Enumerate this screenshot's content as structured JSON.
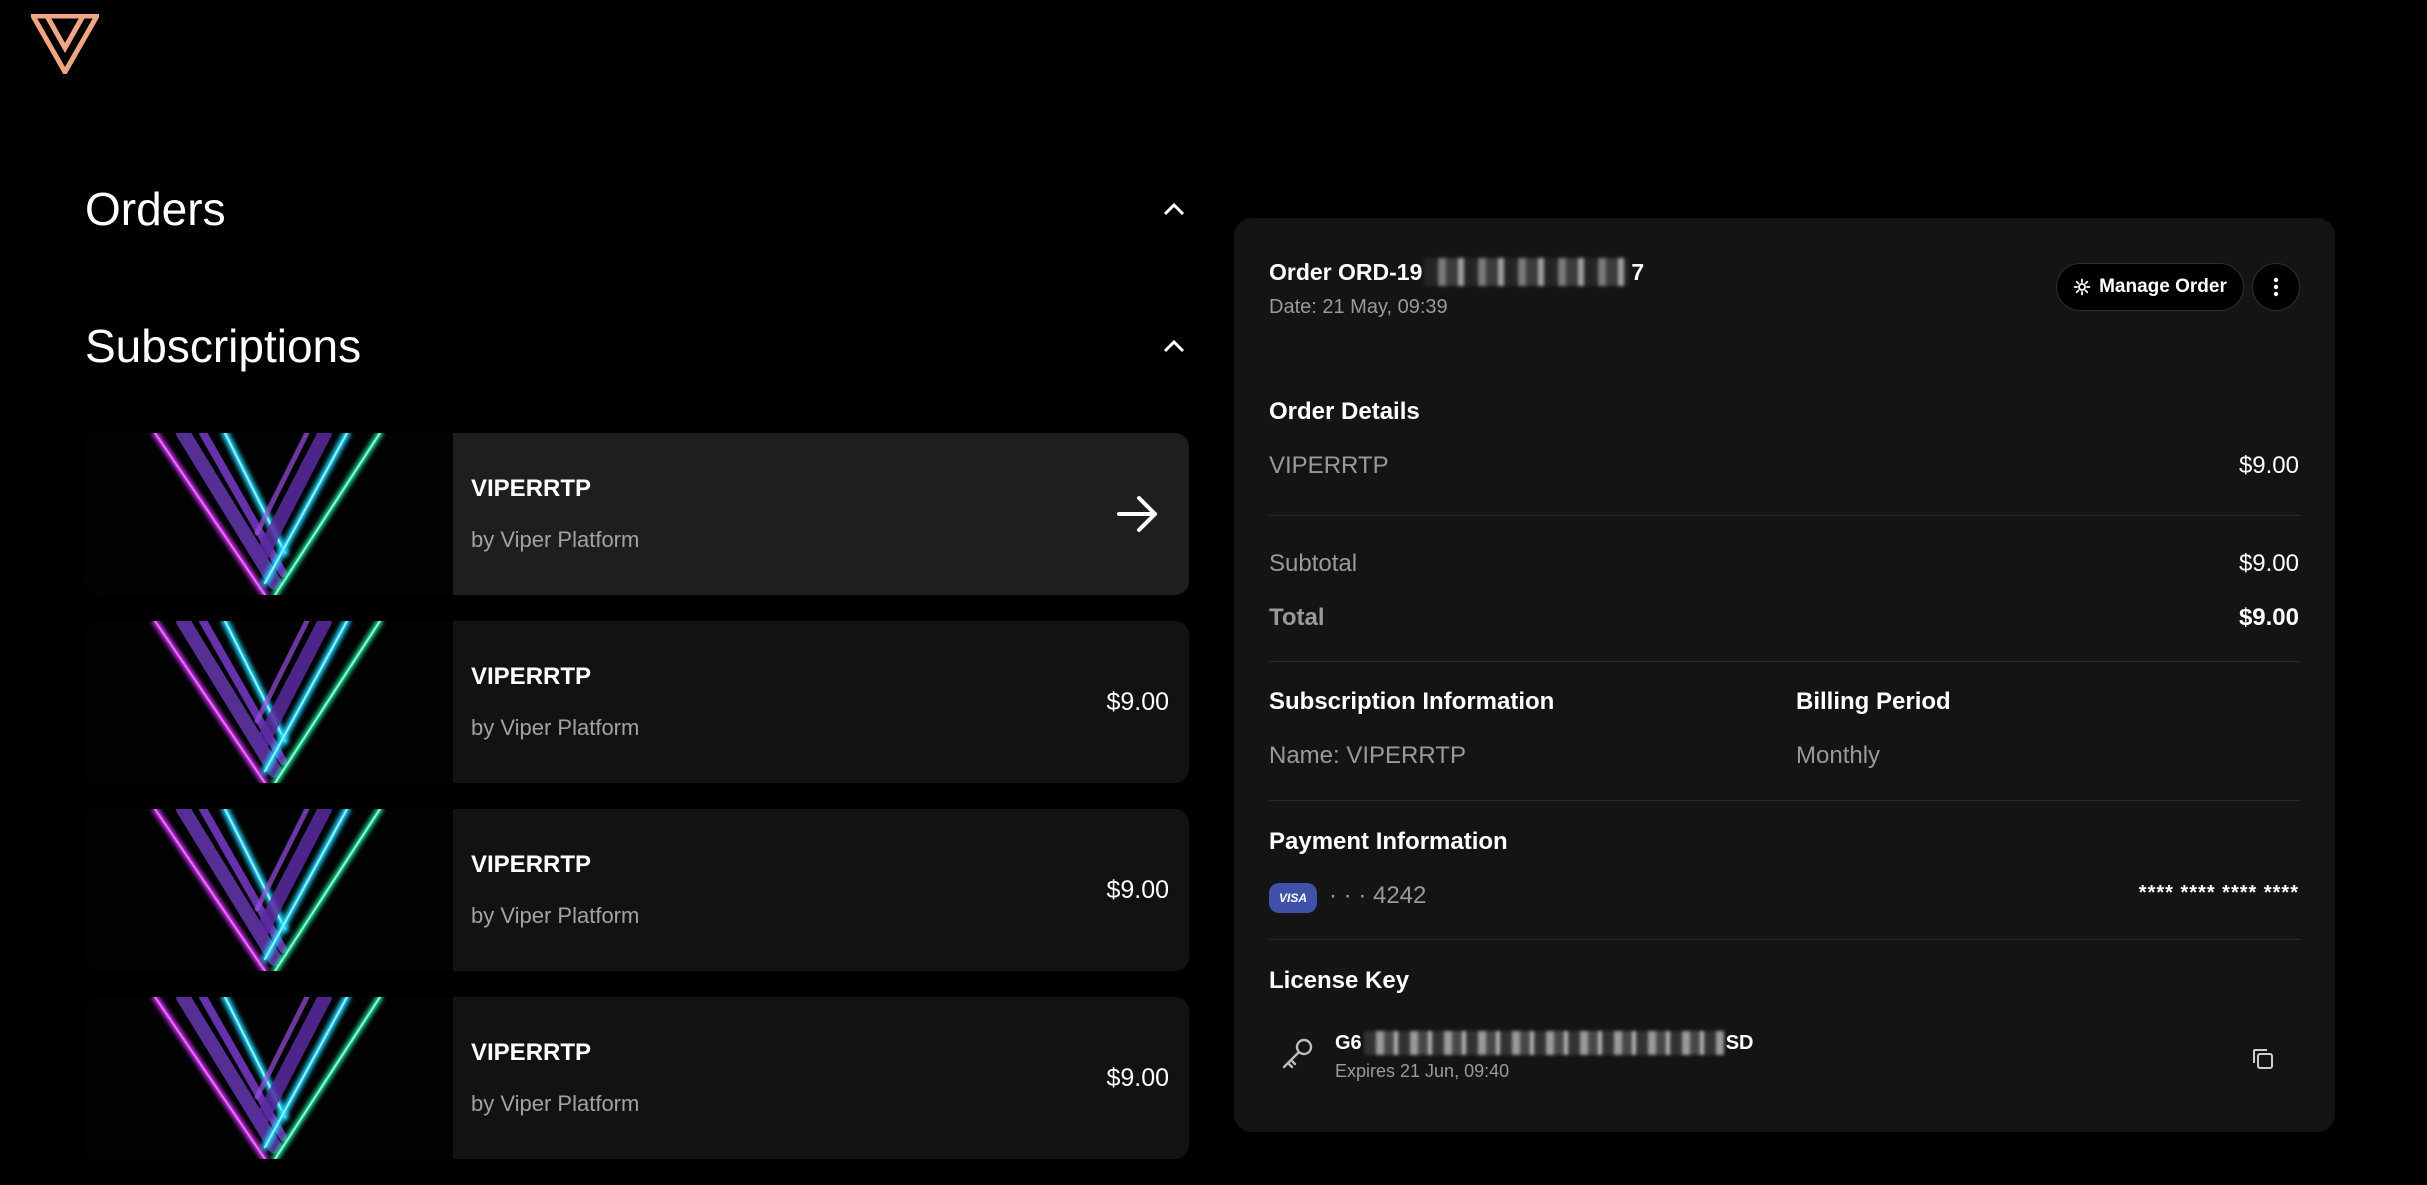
{
  "logo": "viper-logo",
  "sections": {
    "orders_title": "Orders",
    "subscriptions_title": "Subscriptions"
  },
  "subscriptions": [
    {
      "name": "VIPERRTP",
      "by": "by Viper Platform",
      "price": ""
    },
    {
      "name": "VIPERRTP",
      "by": "by Viper Platform",
      "price": "$9.00"
    },
    {
      "name": "VIPERRTP",
      "by": "by Viper Platform",
      "price": "$9.00"
    },
    {
      "name": "VIPERRTP",
      "by": "by Viper Platform",
      "price": "$9.00"
    }
  ],
  "order": {
    "title_prefix": "Order ORD-19",
    "title_suffix": "7",
    "date": "Date: 21 May, 09:39",
    "manage_label": "Manage Order",
    "details_heading": "Order Details",
    "item_name": "VIPERRTP",
    "item_price": "$9.00",
    "subtotal_label": "Subtotal",
    "subtotal_value": "$9.00",
    "total_label": "Total",
    "total_value": "$9.00",
    "subscription_heading": "Subscription Information",
    "subscription_name": "Name: VIPERRTP",
    "billing_heading": "Billing Period",
    "billing_value": "Monthly",
    "payment_heading": "Payment Information",
    "card_brand": "VISA",
    "card_last4": "· · · 4242",
    "card_masked": "**** **** **** ****",
    "license_heading": "License Key",
    "license_prefix": "G6",
    "license_suffix": "SD",
    "license_expires": "Expires 21 Jun, 09:40"
  },
  "colors": {
    "background": "#000000",
    "panel": "#141414",
    "card": "#121212",
    "card_active": "#1e1e1e",
    "logo_accent": "#f0a583",
    "visa_badge": "#3f51a8"
  }
}
